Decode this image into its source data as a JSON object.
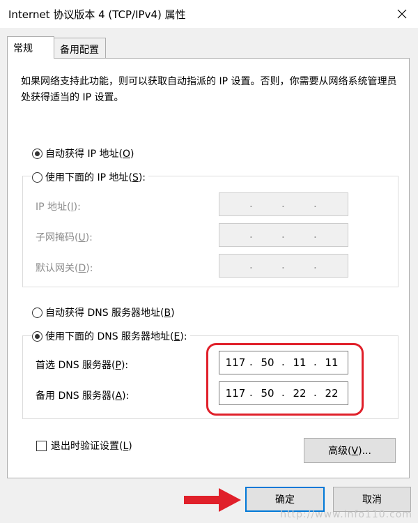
{
  "window": {
    "title": "Internet 协议版本 4 (TCP/IPv4) 属性"
  },
  "tabs": [
    {
      "label": "常规",
      "active": true
    },
    {
      "label": "备用配置",
      "active": false
    }
  ],
  "description": "如果网络支持此功能，则可以获取自动指派的 IP 设置。否则，你需要从网络系统管理员处获得适当的 IP 设置。",
  "ip_section": {
    "auto_label": "自动获得 IP 地址(",
    "auto_key": "O",
    "manual_label": "使用下面的 IP 地址(",
    "manual_key": "S",
    "auto_selected": true,
    "fields": [
      {
        "label": "IP 地址(",
        "key": "I",
        "octets": [
          "",
          "",
          "",
          ""
        ]
      },
      {
        "label": "子网掩码(",
        "key": "U",
        "octets": [
          "",
          "",
          "",
          ""
        ]
      },
      {
        "label": "默认网关(",
        "key": "D",
        "octets": [
          "",
          "",
          "",
          ""
        ]
      }
    ]
  },
  "dns_section": {
    "auto_label": "自动获得 DNS 服务器地址(",
    "auto_key": "B",
    "manual_label": "使用下面的 DNS 服务器地址(",
    "manual_key": "E",
    "manual_selected": true,
    "preferred": {
      "label": "首选 DNS 服务器(",
      "key": "P",
      "octets": [
        "117",
        "50",
        "11",
        "11"
      ]
    },
    "alternate": {
      "label": "备用 DNS 服务器(",
      "key": "A",
      "octets": [
        "117",
        "50",
        "22",
        "22"
      ]
    }
  },
  "validate": {
    "label": "退出时验证设置(",
    "key": "L",
    "checked": false
  },
  "buttons": {
    "advanced_label": "高级(",
    "advanced_key": "V",
    "ok": "确定",
    "cancel": "取消"
  },
  "colors": {
    "highlight": "#e0202a",
    "arrow": "#e0202a",
    "accent": "#0078d7"
  },
  "watermark": "http://www.info110.com"
}
